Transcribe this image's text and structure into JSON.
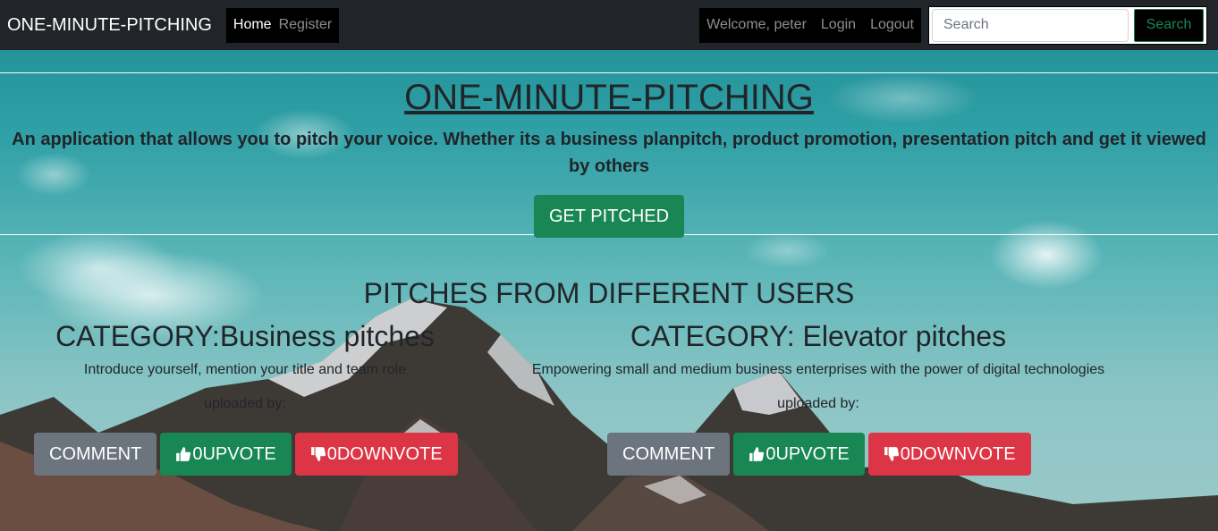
{
  "navbar": {
    "brand": "ONE-MINUTE-PITCHING",
    "links": [
      "Home",
      "Register"
    ],
    "welcome": "Welcome, peter",
    "login": "Login",
    "logout": "Logout",
    "search_placeholder": "Search",
    "search_button": "Search"
  },
  "jumbotron": {
    "title": "ONE-MINUTE-PITCHING",
    "tagline": "An application that allows you to pitch your voice. Whether its a business planpitch, product promotion, presentation pitch and get it viewed by others",
    "cta": "GET PITCHED"
  },
  "section_title": "PITCHES FROM DIFFERENT USERS",
  "pitches": [
    {
      "category": "CATEGORY:Business pitches",
      "description": "Introduce yourself, mention your title and team role",
      "uploaded": "uploaded by:",
      "comment": "COMMENT",
      "upvote_count": "0",
      "upvote": "UPVOTE",
      "downvote_count": "0",
      "downvote": "DOWNVOTE"
    },
    {
      "category": "CATEGORY: Elevator pitches",
      "description": "Empowering small and medium business enterprises with the power of digital technologies",
      "uploaded": "uploaded by:",
      "comment": "COMMENT",
      "upvote_count": "0",
      "upvote": "UPVOTE",
      "downvote_count": "0",
      "downvote": "DOWNVOTE"
    }
  ],
  "icons": [
    "thumbs-up-icon",
    "thumbs-down-icon"
  ],
  "colors": {
    "navbar": "#212529",
    "success": "#198754",
    "secondary": "#6c757d",
    "danger": "#dc3545"
  }
}
